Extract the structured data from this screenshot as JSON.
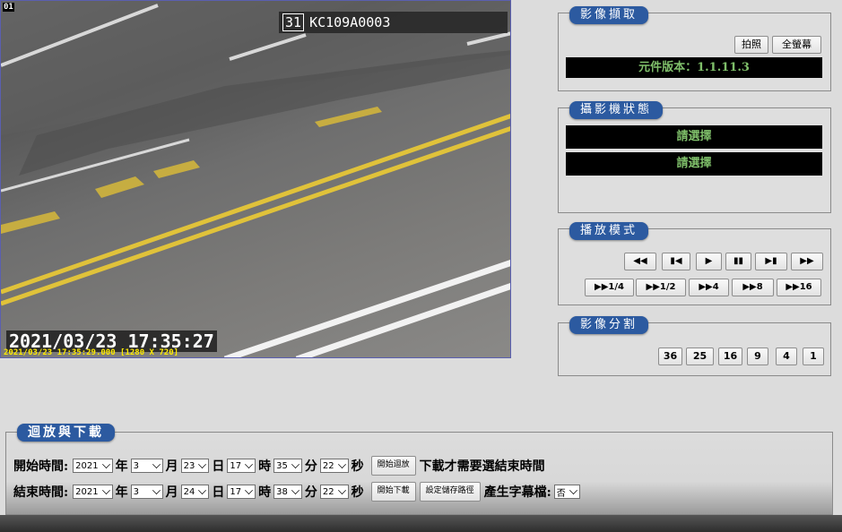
{
  "video": {
    "channel_number": "01",
    "camera_label_num": "31",
    "camera_label_text": "KC109A0003",
    "timestamp_big": "2021/03/23 17:35:27",
    "timestamp_small": "2021/03/23 17:35:29.000 [1280 X 720]"
  },
  "capture_panel": {
    "title": "影像擷取",
    "snapshot_label": "拍照",
    "fullscreen_label": "全螢幕",
    "version_text": "元件版本：1.1.11.3"
  },
  "camera_status_panel": {
    "title": "攝影機狀態",
    "line1": "請選擇",
    "line2": "請選擇"
  },
  "playback_panel": {
    "title": "播放模式",
    "row1": [
      {
        "name": "rewind-button",
        "label": "◀◀"
      },
      {
        "name": "step-back-button",
        "label": "▮◀"
      },
      {
        "name": "play-button",
        "label": "▶"
      },
      {
        "name": "pause-button",
        "label": "▮▮"
      },
      {
        "name": "step-forward-button",
        "label": "▶▮"
      },
      {
        "name": "fast-forward-button",
        "label": "▶▶"
      }
    ],
    "row2": [
      {
        "name": "speed-quarter-button",
        "label": "▶▶1/4"
      },
      {
        "name": "speed-half-button",
        "label": "▶▶1/2"
      },
      {
        "name": "speed-4x-button",
        "label": "▶▶4"
      },
      {
        "name": "speed-8x-button",
        "label": "▶▶8"
      },
      {
        "name": "speed-16x-button",
        "label": "▶▶16"
      }
    ]
  },
  "split_panel": {
    "title": "影像分割",
    "options": [
      "36",
      "25",
      "16",
      "9",
      "4",
      "1"
    ]
  },
  "playback_download": {
    "title": "迴放與下載",
    "start_label": "開始時間:",
    "end_label": "結束時間:",
    "unit_year": "年",
    "unit_month": "月",
    "unit_day": "日",
    "unit_hour": "時",
    "unit_minute": "分",
    "unit_second": "秒",
    "start": {
      "year": "2021",
      "month": "3",
      "day": "23",
      "hour": "17",
      "minute": "35",
      "second": "22"
    },
    "end": {
      "year": "2021",
      "month": "3",
      "day": "24",
      "hour": "17",
      "minute": "38",
      "second": "22"
    },
    "start_playback_label": "開始迴放",
    "download_note": "下載才需要選結束時間",
    "start_download_label": "開始下載",
    "set_save_path_label": "設定儲存路徑",
    "subtitle_label": "產生字幕檔:",
    "subtitle_value": "否"
  },
  "colors": {
    "accent": "#2c5aa0",
    "status_green": "#7fbf6a",
    "timestamp_yellow": "#ffeb00"
  }
}
